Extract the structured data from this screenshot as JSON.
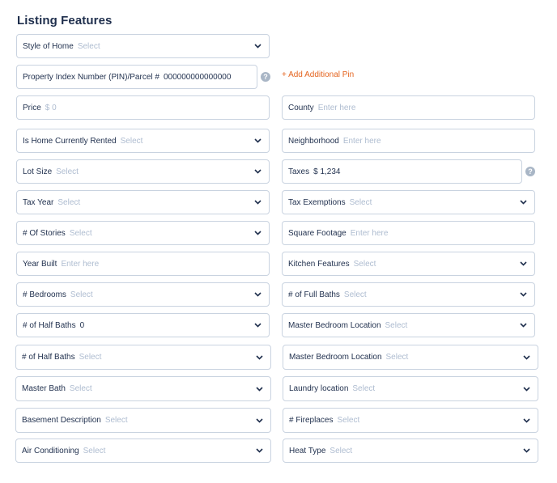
{
  "section_title": "Listing Features",
  "add_pin_label": "+ Add Additional Pin",
  "fields": {
    "style_of_home": {
      "label": "Style of Home",
      "value": "Select"
    },
    "pin": {
      "label": "Property Index Number (PIN)/Parcel #",
      "value": "000000000000000"
    },
    "price": {
      "label": "Price",
      "value": "$ 0"
    },
    "county": {
      "label": "County",
      "value": "Enter here"
    },
    "home_rented": {
      "label": "Is Home Currently Rented",
      "value": "Select"
    },
    "neighborhood": {
      "label": "Neighborhood",
      "value": "Enter here"
    },
    "lot_size": {
      "label": "Lot Size",
      "value": "Select"
    },
    "taxes": {
      "label": "Taxes",
      "value": "$ 1,234"
    },
    "tax_year": {
      "label": "Tax Year",
      "value": "Select"
    },
    "tax_exemptions": {
      "label": "Tax Exemptions",
      "value": "Select"
    },
    "stories": {
      "label": "# Of Stories",
      "value": "Select"
    },
    "square_footage": {
      "label": "Square Footage",
      "value": "Enter here"
    },
    "year_built": {
      "label": "Year Built",
      "value": "Enter here"
    },
    "kitchen_features": {
      "label": "Kitchen Features",
      "value": "Select"
    },
    "bedrooms": {
      "label": "# Bedrooms",
      "value": "Select"
    },
    "full_baths": {
      "label": "# of Full Baths",
      "value": "Select"
    },
    "half_baths_1": {
      "label": "# of Half Baths",
      "value": "0"
    },
    "master_bedroom_1": {
      "label": "Master Bedroom Location",
      "value": "Select"
    },
    "half_baths_2": {
      "label": "# of Half Baths",
      "value": "Select"
    },
    "master_bedroom_2": {
      "label": "Master Bedroom Location",
      "value": "Select"
    },
    "master_bath": {
      "label": "Master Bath",
      "value": "Select"
    },
    "laundry_location": {
      "label": "Laundry location",
      "value": "Select"
    },
    "basement_description": {
      "label": "Basement Description",
      "value": "Select"
    },
    "fireplaces": {
      "label": "# Fireplaces",
      "value": "Select"
    },
    "air_conditioning": {
      "label": "Air Conditioning",
      "value": "Select"
    },
    "heat_type": {
      "label": "Heat Type",
      "value": "Select"
    }
  }
}
